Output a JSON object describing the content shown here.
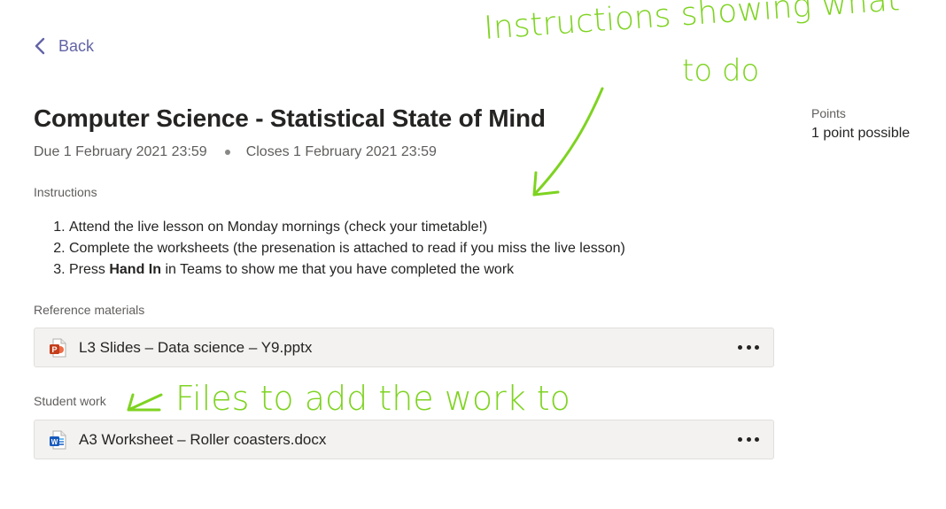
{
  "nav": {
    "back_label": "Back"
  },
  "assignment": {
    "title": "Computer Science - Statistical State of Mind",
    "due": "Due 1 February 2021 23:59",
    "closes": "Closes 1 February 2021 23:59"
  },
  "points": {
    "label": "Points",
    "value": "1 point possible"
  },
  "instructions": {
    "label": "Instructions",
    "items": [
      {
        "text": "Attend the live lesson on Monday mornings (check your timetable!)"
      },
      {
        "text": "Complete the worksheets (the presenation is attached to read if you miss the live lesson)"
      },
      {
        "prefix": "Press ",
        "bold": "Hand In",
        "suffix": " in Teams to show me that you have completed the work"
      }
    ]
  },
  "reference_materials": {
    "label": "Reference materials",
    "files": [
      {
        "name": "L3 Slides – Data science – Y9.pptx",
        "type": "powerpoint-icon"
      }
    ]
  },
  "student_work": {
    "label": "Student work",
    "files": [
      {
        "name": "A3 Worksheet – Roller coasters.docx",
        "type": "word-icon"
      }
    ]
  },
  "annotations": {
    "top_note_line1": "Instructions showing what",
    "top_note_line2": "to do",
    "student_note": "Files to add the work to",
    "color": "#7ed321"
  },
  "colors": {
    "accent": "#6264a7",
    "card_bg": "#f3f2f1",
    "powerpoint": "#c43e1c",
    "word": "#185abd"
  }
}
